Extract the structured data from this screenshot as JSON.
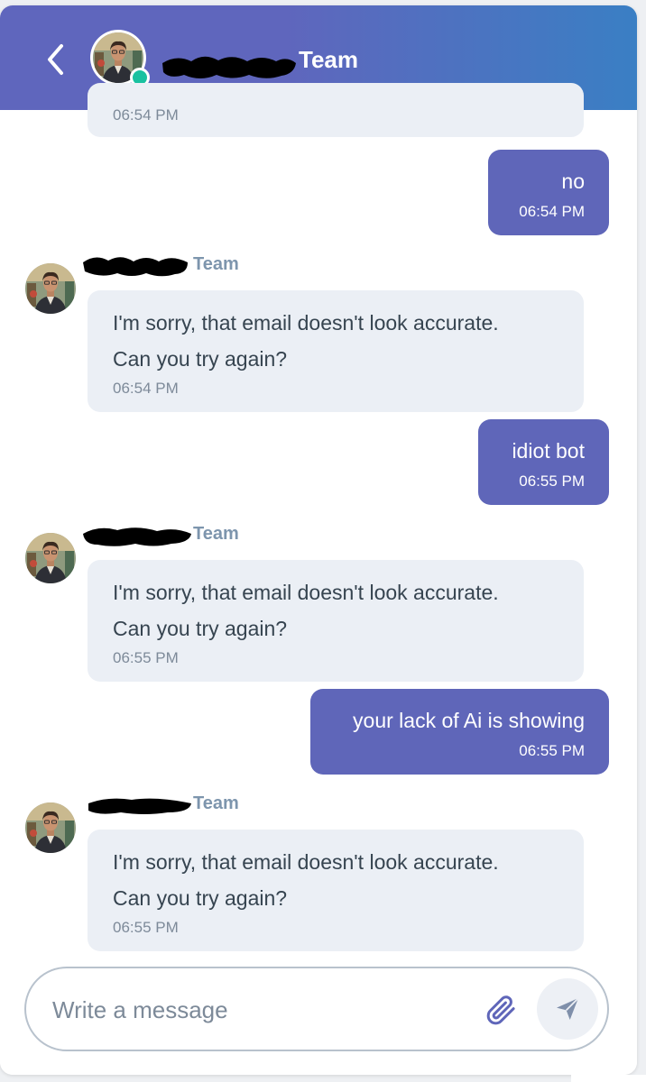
{
  "header": {
    "team_label": "Team",
    "back_icon": "chevron-left-icon",
    "online_status_color": "#19c1a0"
  },
  "messages": [
    {
      "from": "bot",
      "partial": true,
      "time": "06:54 PM"
    },
    {
      "from": "user",
      "text": "no",
      "time": "06:54 PM"
    },
    {
      "from": "bot",
      "team": "Team",
      "line1": "I'm sorry, that email doesn't look accurate.",
      "line2": "Can you try again?",
      "time": "06:54 PM"
    },
    {
      "from": "user",
      "text": "idiot bot",
      "time": "06:55 PM"
    },
    {
      "from": "bot",
      "team": "Team",
      "line1": "I'm sorry, that email doesn't look accurate.",
      "line2": "Can you try again?",
      "time": "06:55 PM"
    },
    {
      "from": "user",
      "text": "your lack of Ai is showing",
      "time": "06:55 PM"
    },
    {
      "from": "bot",
      "team": "Team",
      "line1": "I'm sorry, that email doesn't look accurate.",
      "line2": "Can you try again?",
      "time": "06:55 PM"
    }
  ],
  "composer": {
    "placeholder": "Write a message",
    "attach_icon": "paperclip-icon",
    "send_icon": "send-icon"
  },
  "colors": {
    "header_start": "#5f66bd",
    "header_end": "#3a7fc4",
    "user_bubble": "#5f66b9",
    "bot_bubble": "#ebeff5",
    "team_label": "#7d95ad"
  }
}
